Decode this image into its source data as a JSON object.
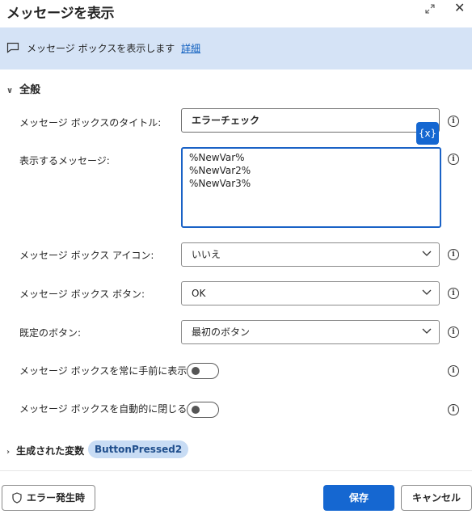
{
  "dialog": {
    "title": "メッセージを表示"
  },
  "infobar": {
    "text": "メッセージ ボックスを表示します",
    "link": "詳細"
  },
  "section": {
    "label": "全般"
  },
  "fields": {
    "title": {
      "label": "メッセージ ボックスのタイトル:",
      "value": "エラーチェック"
    },
    "message": {
      "label": "表示するメッセージ:",
      "lines": [
        "%NewVar%",
        "%NewVar2%",
        "%NewVar3%"
      ]
    },
    "icon": {
      "label": "メッセージ ボックス アイコン:",
      "value": "いいえ"
    },
    "buttons": {
      "label": "メッセージ ボックス ボタン:",
      "value": "OK"
    },
    "default_button": {
      "label": "既定のボタン:",
      "value": "最初のボタン"
    },
    "topmost": {
      "label": "メッセージ ボックスを常に手前に表示する:",
      "on": false
    },
    "autoclose": {
      "label": "メッセージ ボックスを自動的に閉じる:",
      "on": false
    }
  },
  "var_button": "{x}",
  "info_glyph": "i",
  "generated": {
    "label": "生成された変数",
    "badge": "ButtonPressed2"
  },
  "footer": {
    "error_label": "エラー発生時",
    "save": "保存",
    "cancel": "キャンセル"
  },
  "colors": {
    "accent": "#1567d1",
    "infobar": "#d5e3f6",
    "badge": "#c8dcf4"
  }
}
